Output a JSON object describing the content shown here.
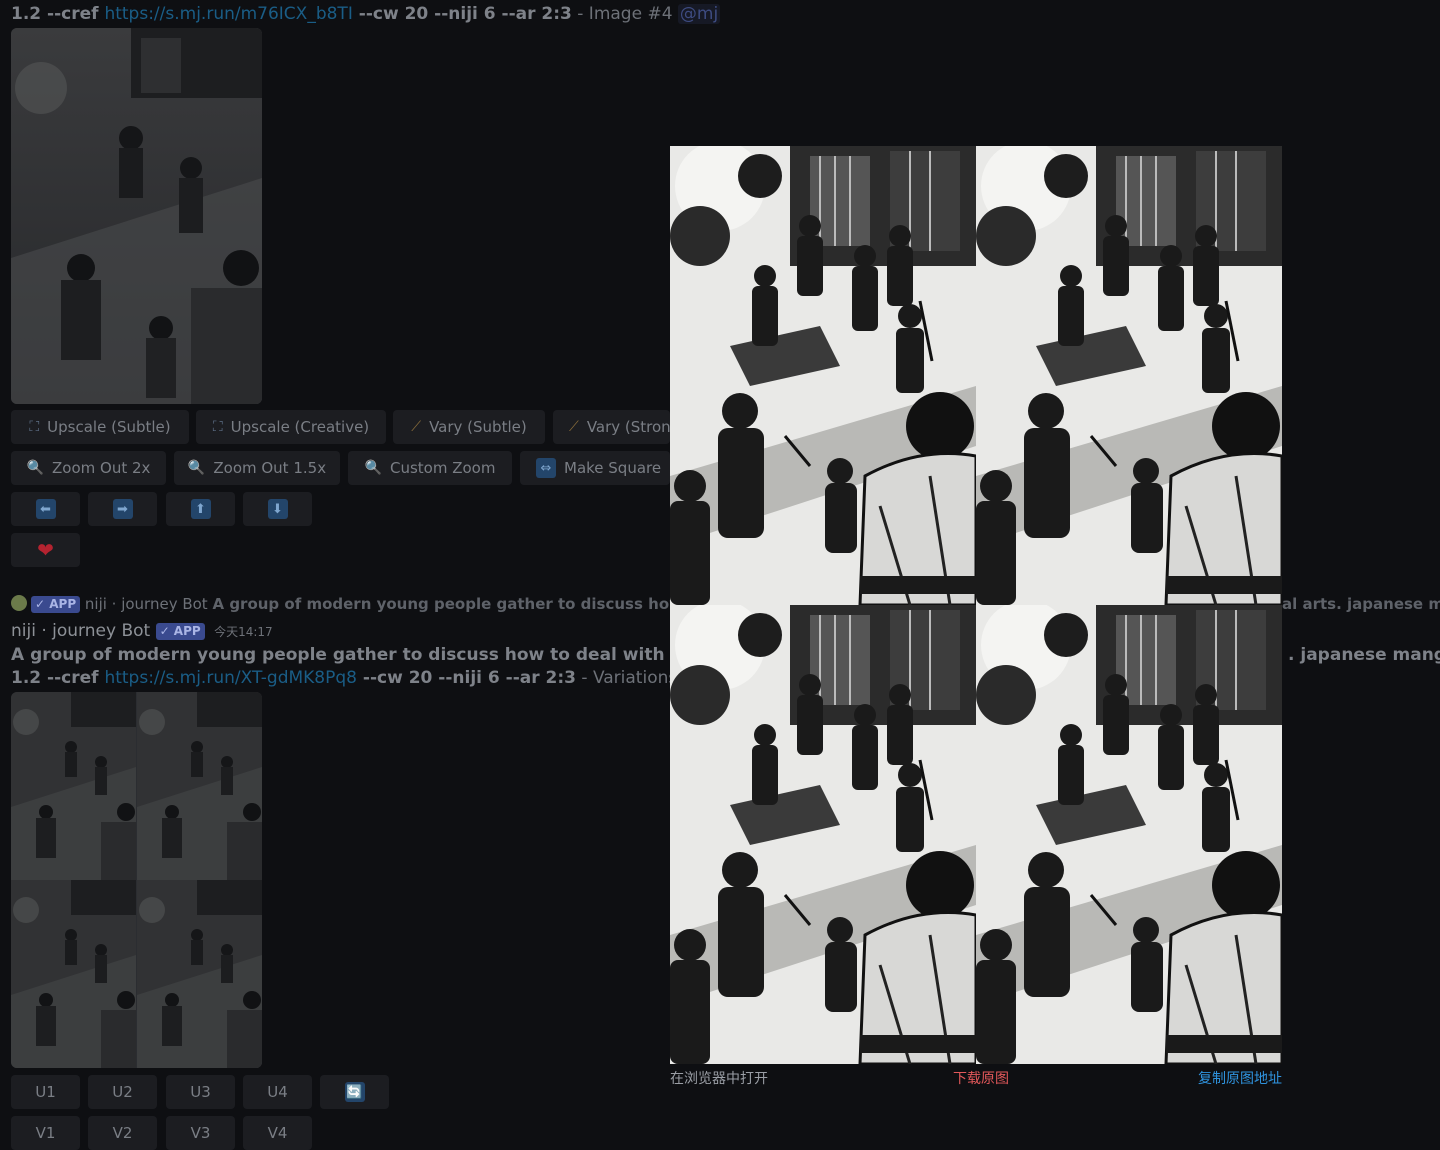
{
  "msg1": {
    "prompt_prefix": "1.2 --cref ",
    "link": "https://s.mj.run/m76ICX_b8TI",
    "params": " --cw 20 --niji 6 --ar 2:3",
    "suffix": " - Image #4 ",
    "mention": "@mj",
    "buttons_row1": [
      {
        "icon": "upscale-icon",
        "label": "Upscale (Subtle)"
      },
      {
        "icon": "upscale-icon",
        "label": "Upscale (Creative)"
      },
      {
        "icon": "magic-wand-icon",
        "label": "Vary (Subtle)"
      },
      {
        "icon": "magic-wand-icon",
        "label": "Vary (Stron"
      }
    ],
    "buttons_row2": [
      {
        "icon": "magnifier-icon",
        "label": "Zoom Out 2x"
      },
      {
        "icon": "magnifier-icon",
        "label": "Zoom Out 1.5x"
      },
      {
        "icon": "magnifier-icon",
        "label": "Custom Zoom"
      },
      {
        "icon": "arrows-horizontal-icon",
        "label": "Make Square"
      }
    ],
    "arrow_buttons": [
      "⬅",
      "➡",
      "⬆",
      "⬇"
    ],
    "heart": "❤"
  },
  "msg2": {
    "reply_badge": "✓ APP",
    "reply_author": "niji · journey Bot",
    "reply_text_start": "A group of modern young people gather to discuss how to d",
    "reply_text_end": "al arts. japanese man",
    "author": "niji · journey Bot",
    "badge": "✓ APP",
    "time": "今天14:17",
    "line1_start": "A group of modern young people gather to discuss how to deal with the arr",
    "line1_end": ". japanese manga,",
    "prompt_prefix": "1.2 --cref ",
    "link": "https://s.mj.run/XT-gdMK8Pq8",
    "params": " --cw 20 --niji 6 --ar 2:3",
    "suffix": " - Variations",
    "u_buttons": [
      "U1",
      "U2",
      "U3",
      "U4"
    ],
    "reroll": "🔄",
    "v_buttons": [
      "V1",
      "V2",
      "V3",
      "V4"
    ]
  },
  "preview": {
    "open_in_browser": "在浏览器中打开",
    "download_original": "下载原图",
    "copy_original_url": "复制原图地址"
  },
  "colors": {
    "background": "#0e0f12",
    "button_bg": "#1c1d21",
    "link": "#1a5d86",
    "download": "#e2585a",
    "copy": "#2f93de",
    "badge": "#3a4a8f"
  }
}
